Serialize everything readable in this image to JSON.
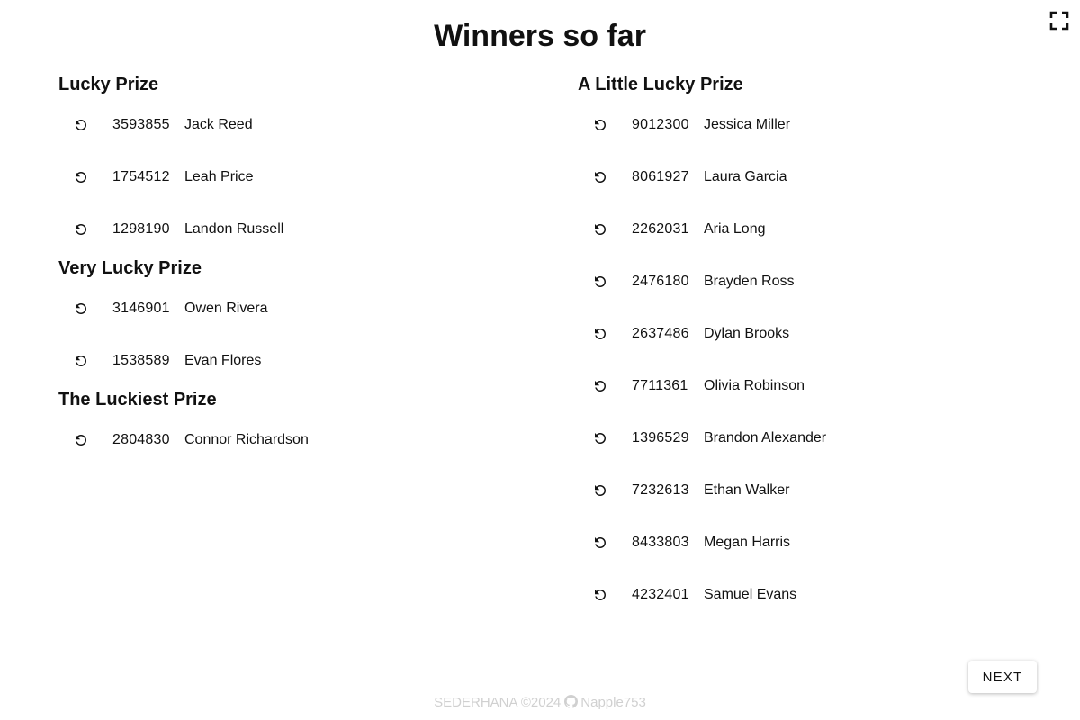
{
  "page": {
    "title": "Winners so far"
  },
  "icons": {
    "fullscreen": "fullscreen-icon",
    "reroll": "refresh-icon",
    "github": "github-icon"
  },
  "left_column": [
    {
      "prize": "Lucky Prize",
      "winners": [
        {
          "ticket": "3593855",
          "name": "Jack Reed"
        },
        {
          "ticket": "1754512",
          "name": "Leah Price"
        },
        {
          "ticket": "1298190",
          "name": "Landon Russell"
        }
      ]
    },
    {
      "prize": "Very Lucky Prize",
      "winners": [
        {
          "ticket": "3146901",
          "name": "Owen Rivera"
        },
        {
          "ticket": "1538589",
          "name": "Evan Flores"
        }
      ]
    },
    {
      "prize": "The Luckiest Prize",
      "winners": [
        {
          "ticket": "2804830",
          "name": "Connor Richardson"
        }
      ]
    }
  ],
  "right_column": [
    {
      "prize": "A Little Lucky Prize",
      "winners": [
        {
          "ticket": "9012300",
          "name": "Jessica Miller"
        },
        {
          "ticket": "8061927",
          "name": "Laura Garcia"
        },
        {
          "ticket": "2262031",
          "name": "Aria Long"
        },
        {
          "ticket": "2476180",
          "name": "Brayden Ross"
        },
        {
          "ticket": "2637486",
          "name": "Dylan Brooks"
        },
        {
          "ticket": "7711361",
          "name": "Olivia Robinson"
        },
        {
          "ticket": "1396529",
          "name": "Brandon Alexander"
        },
        {
          "ticket": "7232613",
          "name": "Ethan Walker"
        },
        {
          "ticket": "8433803",
          "name": "Megan Harris"
        },
        {
          "ticket": "4232401",
          "name": "Samuel Evans"
        }
      ]
    }
  ],
  "actions": {
    "next_label": "NEXT"
  },
  "footer": {
    "brand": "SEDERHANA ©2024",
    "author": "Napple753"
  }
}
